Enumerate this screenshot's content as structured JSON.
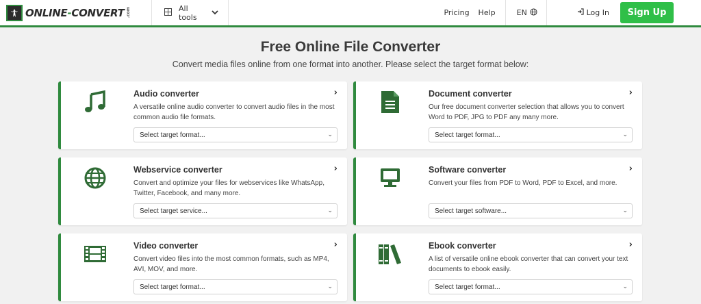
{
  "header": {
    "logo_main": "ONLINE",
    "logo_dash": "-",
    "logo_second": "CONVERT",
    "logo_com": ".com",
    "alltools_label": "All tools",
    "pricing_label": "Pricing",
    "help_label": "Help",
    "lang_label": "EN",
    "login_label": "Log In",
    "signup_label": "Sign Up"
  },
  "main": {
    "title": "Free Online File Converter",
    "subtitle": "Convert media files online from one format into another. Please select the target format below:"
  },
  "colors": {
    "accent": "#2f8a3e",
    "signup": "#2fbf48"
  },
  "cards": [
    {
      "icon": "music-note-icon",
      "title": "Audio converter",
      "description": "A versatile online audio converter to convert audio files in the most common audio file formats.",
      "select_value": "Select target format..."
    },
    {
      "icon": "document-icon",
      "title": "Document converter",
      "description": "Our free document converter selection that allows you to convert Word to PDF, JPG to PDF any many more.",
      "select_value": "Select target format..."
    },
    {
      "icon": "globe-icon",
      "title": "Webservice converter",
      "description": "Convert and optimize your files for webservices like WhatsApp, Twitter, Facebook, and many more.",
      "select_value": "Select target service..."
    },
    {
      "icon": "desktop-icon",
      "title": "Software converter",
      "description": "Convert your files from PDF to Word, PDF to Excel, and more.",
      "select_value": "Select target software..."
    },
    {
      "icon": "film-icon",
      "title": "Video converter",
      "description": "Convert video files into the most common formats, such as MP4, AVI, MOV, and more.",
      "select_value": "Select target format..."
    },
    {
      "icon": "books-icon",
      "title": "Ebook converter",
      "description": "A list of versatile online ebook converter that can convert your text documents to ebook easily.",
      "select_value": "Select target format..."
    }
  ]
}
